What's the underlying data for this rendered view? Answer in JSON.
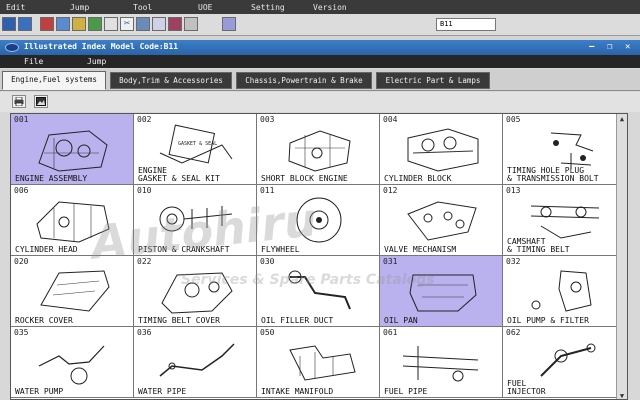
{
  "top_menu": {
    "items": [
      "Edit",
      "Jump",
      "Tool",
      "UOE",
      "Setting",
      "Version"
    ]
  },
  "top_toolbar": {
    "field_value": "B11"
  },
  "window": {
    "title": "Illustrated Index Model Code:B11",
    "min_glyph": "—",
    "max_glyph": "❐",
    "close_glyph": "✕"
  },
  "window_menu": {
    "file": "File",
    "jump": "Jump"
  },
  "tabs": [
    "Engine,Fuel systems",
    "Body,Trim & Accessories",
    "Chassis,Powertrain & Brake",
    "Electric Part & Lamps"
  ],
  "parts": [
    {
      "code": "001",
      "name": "ENGINE ASSEMBLY",
      "selected": true
    },
    {
      "code": "002",
      "name": "ENGINE\nGASKET & SEAL KIT",
      "selected": false
    },
    {
      "code": "003",
      "name": "SHORT BLOCK ENGINE",
      "selected": false
    },
    {
      "code": "004",
      "name": "CYLINDER BLOCK",
      "selected": false
    },
    {
      "code": "005",
      "name": "TIMING HOLE PLUG\n& TRANSMISSION BOLT",
      "selected": false
    },
    {
      "code": "006",
      "name": "CYLINDER HEAD",
      "selected": false
    },
    {
      "code": "010",
      "name": "PISTON & CRANKSHAFT",
      "selected": false
    },
    {
      "code": "011",
      "name": "FLYWHEEL",
      "selected": false
    },
    {
      "code": "012",
      "name": "VALVE MECHANISM",
      "selected": false
    },
    {
      "code": "013",
      "name": "CAMSHAFT\n& TIMING BELT",
      "selected": false
    },
    {
      "code": "020",
      "name": "ROCKER COVER",
      "selected": false
    },
    {
      "code": "022",
      "name": "TIMING BELT COVER",
      "selected": false
    },
    {
      "code": "030",
      "name": "OIL FILLER DUCT",
      "selected": false
    },
    {
      "code": "031",
      "name": "OIL PAN",
      "selected": true
    },
    {
      "code": "032",
      "name": "OIL PUMP & FILTER",
      "selected": false
    },
    {
      "code": "035",
      "name": "WATER PUMP",
      "selected": false
    },
    {
      "code": "036",
      "name": "WATER PIPE",
      "selected": false
    },
    {
      "code": "050",
      "name": "INTAKE MANIFOLD",
      "selected": false
    },
    {
      "code": "061",
      "name": "FUEL PIPE",
      "selected": false
    },
    {
      "code": "062",
      "name": "FUEL\nINJECTOR",
      "selected": false
    }
  ],
  "watermark": {
    "line1": "Autohiru",
    "line2": "Services & Spare Parts Catalogs"
  },
  "colors": {
    "selected_cell": "#b9b2ef",
    "titlebar": "#2a63a8",
    "menubar": "#262626"
  }
}
